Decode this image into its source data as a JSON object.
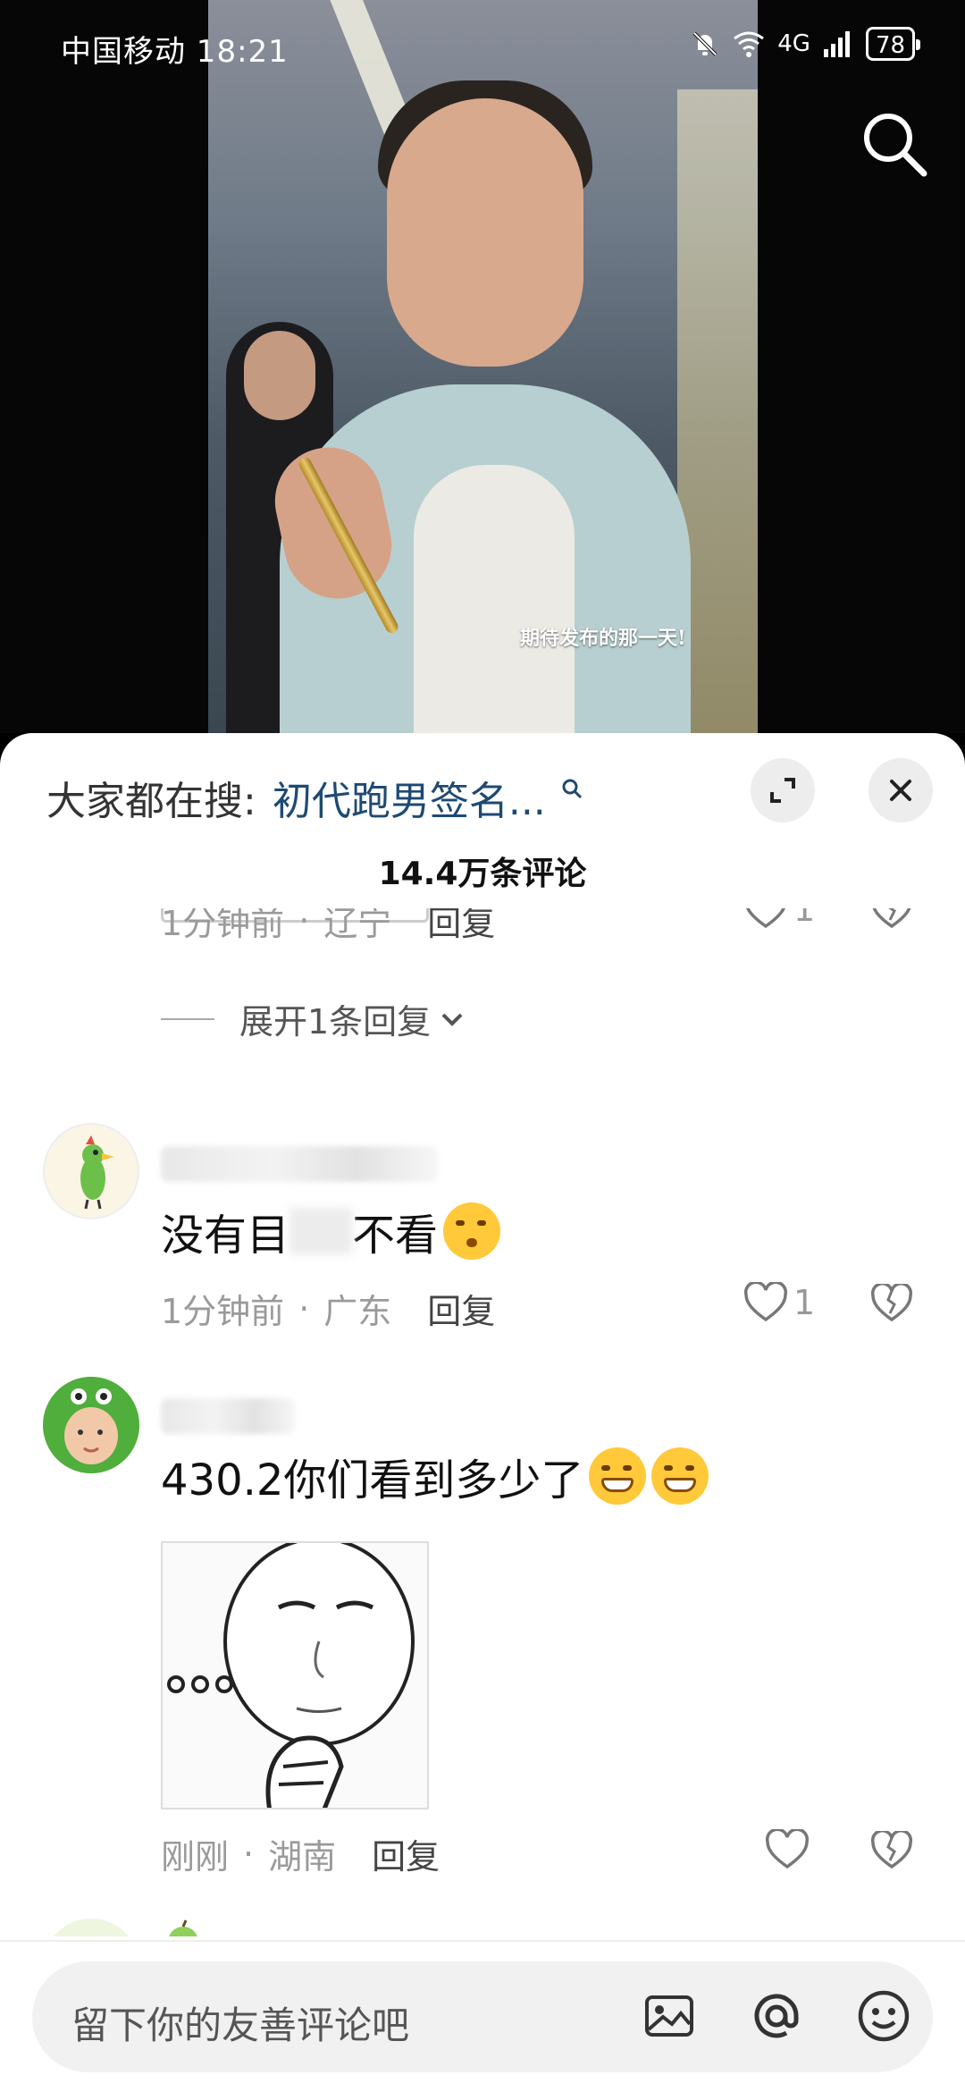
{
  "status_bar": {
    "carrier": "中国移动 18:21",
    "network": "4G",
    "battery": "78"
  },
  "video": {
    "caption": "期待发布的那一天!"
  },
  "sheet": {
    "hot_search_label": "大家都在搜:",
    "hot_search_term": "初代跑男签名...",
    "comment_count": "14.4万条评论"
  },
  "comments": [
    {
      "time": "1分钟前",
      "location": "辽宁",
      "reply_label": "回复",
      "likes": "1",
      "expand_replies": "展开1条回复"
    },
    {
      "text": "没有目",
      "text_after": "不看",
      "time": "1分钟前",
      "location": "广东",
      "reply_label": "回复",
      "likes": "1"
    },
    {
      "text": "430.2你们看到多少了",
      "time": "刚刚",
      "location": "湖南",
      "reply_label": "回复",
      "likes": ""
    }
  ],
  "input": {
    "placeholder": "留下你的友善评论吧"
  },
  "colors": {
    "hot_search_term": "#1e4a73",
    "sheet_bg": "#ffffff",
    "input_bg": "#f1f1f1"
  },
  "icons": [
    "search-icon",
    "expand-icon",
    "close-icon",
    "heart-icon",
    "broken-heart-icon",
    "image-icon",
    "at-icon",
    "emoji-icon",
    "chevron-down-icon"
  ]
}
